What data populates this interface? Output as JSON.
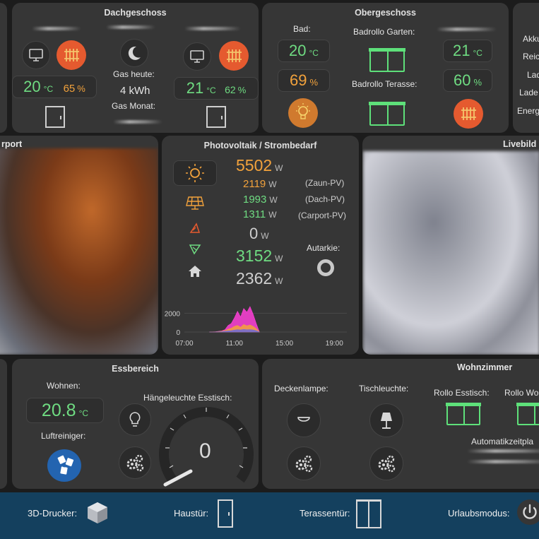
{
  "dachgeschoss": {
    "title": "Dachgeschoss",
    "gas_today_label": "Gas heute:",
    "gas_today_value": "4 kWh",
    "gas_month_label": "Gas Monat:",
    "left": {
      "temp": "20",
      "temp_unit": "°C",
      "humidity": "65",
      "hum_unit": "%"
    },
    "right": {
      "temp": "21",
      "temp_unit": "°C",
      "humidity": "62",
      "hum_unit": "%"
    }
  },
  "obergeschoss": {
    "title": "Obergeschoss",
    "bad_label": "Bad:",
    "bad_temp": "20",
    "bad_temp_unit": "°C",
    "bad_hum": "69",
    "bad_hum_unit": "%",
    "rollo_garten_label": "Badrollo Garten:",
    "rollo_terasse_label": "Badrollo Terasse:",
    "right_temp": "21",
    "right_temp_unit": "°C",
    "right_hum": "60",
    "right_hum_unit": "%"
  },
  "right_panel": {
    "labels": [
      "Akku",
      "Reic",
      "Lad",
      "Lade",
      "Energ"
    ]
  },
  "carport": {
    "title": "rport"
  },
  "photovoltaik": {
    "title": "Photovoltaik / Strombedarf",
    "unit": "W",
    "total": "5502",
    "zaun": "2119",
    "zaun_label": "(Zaun-PV)",
    "dach": "1993",
    "dach_label": "(Dach-PV)",
    "carport": "1311",
    "carport_label": "(Carport-PV)",
    "battery": "0",
    "grid": "3152",
    "house": "2362",
    "autarkie_label": "Autarkie:"
  },
  "livebild": {
    "title": "Livebild"
  },
  "essbereich": {
    "title": "Essbereich",
    "wohnen_label": "Wohnen:",
    "wohnen_temp": "20.8",
    "wohnen_unit": "°C",
    "luftreiniger_label": "Luftreiniger:",
    "haengeleuchte_label": "Hängeleuchte Esstisch:",
    "dimmer_value": "0"
  },
  "wohnzimmer": {
    "title": "Wohnzimmer",
    "deckenlampe_label": "Deckenlampe:",
    "tischleuchte_label": "Tischleuchte:",
    "rollo_esstisch_label": "Rollo Esstisch:",
    "rollo_wo_label": "Rollo Wo",
    "automatik_label": "Automatikzeitpla"
  },
  "footer": {
    "drucker_label": "3D-Drucker:",
    "haustuer_label": "Haustür:",
    "terassentuer_label": "Terassentür:",
    "urlaub_label": "Urlaubsmodus:"
  },
  "chart_data": {
    "type": "area",
    "x_ticks": [
      "07:00",
      "11:00",
      "15:00",
      "19:00"
    ],
    "y_ticks": [
      "2000",
      "0"
    ],
    "ylim": [
      0,
      3000
    ],
    "x": [
      "09:00",
      "09:30",
      "10:00",
      "10:15",
      "10:30",
      "10:45",
      "11:00",
      "11:15",
      "11:30",
      "11:45",
      "12:00",
      "12:15",
      "12:30",
      "12:45",
      "13:00"
    ],
    "series": [
      {
        "color": "#ff3fd8",
        "values": [
          0,
          30,
          120,
          250,
          700,
          900,
          1500,
          2200,
          1600,
          2500,
          2100,
          2700,
          1900,
          900,
          0
        ]
      },
      {
        "color": "#f2a23c",
        "values": [
          0,
          20,
          80,
          150,
          300,
          400,
          600,
          700,
          500,
          800,
          650,
          750,
          600,
          350,
          0
        ]
      },
      {
        "color": "#6e6ad6",
        "values": [
          0,
          10,
          40,
          80,
          120,
          150,
          200,
          250,
          220,
          280,
          240,
          260,
          220,
          150,
          0
        ]
      }
    ]
  },
  "colors": {
    "accent_green": "#6fdc82",
    "accent_orange": "#f2a23c",
    "heater_red": "#e55a2f",
    "footer_blue": "#14405e"
  }
}
